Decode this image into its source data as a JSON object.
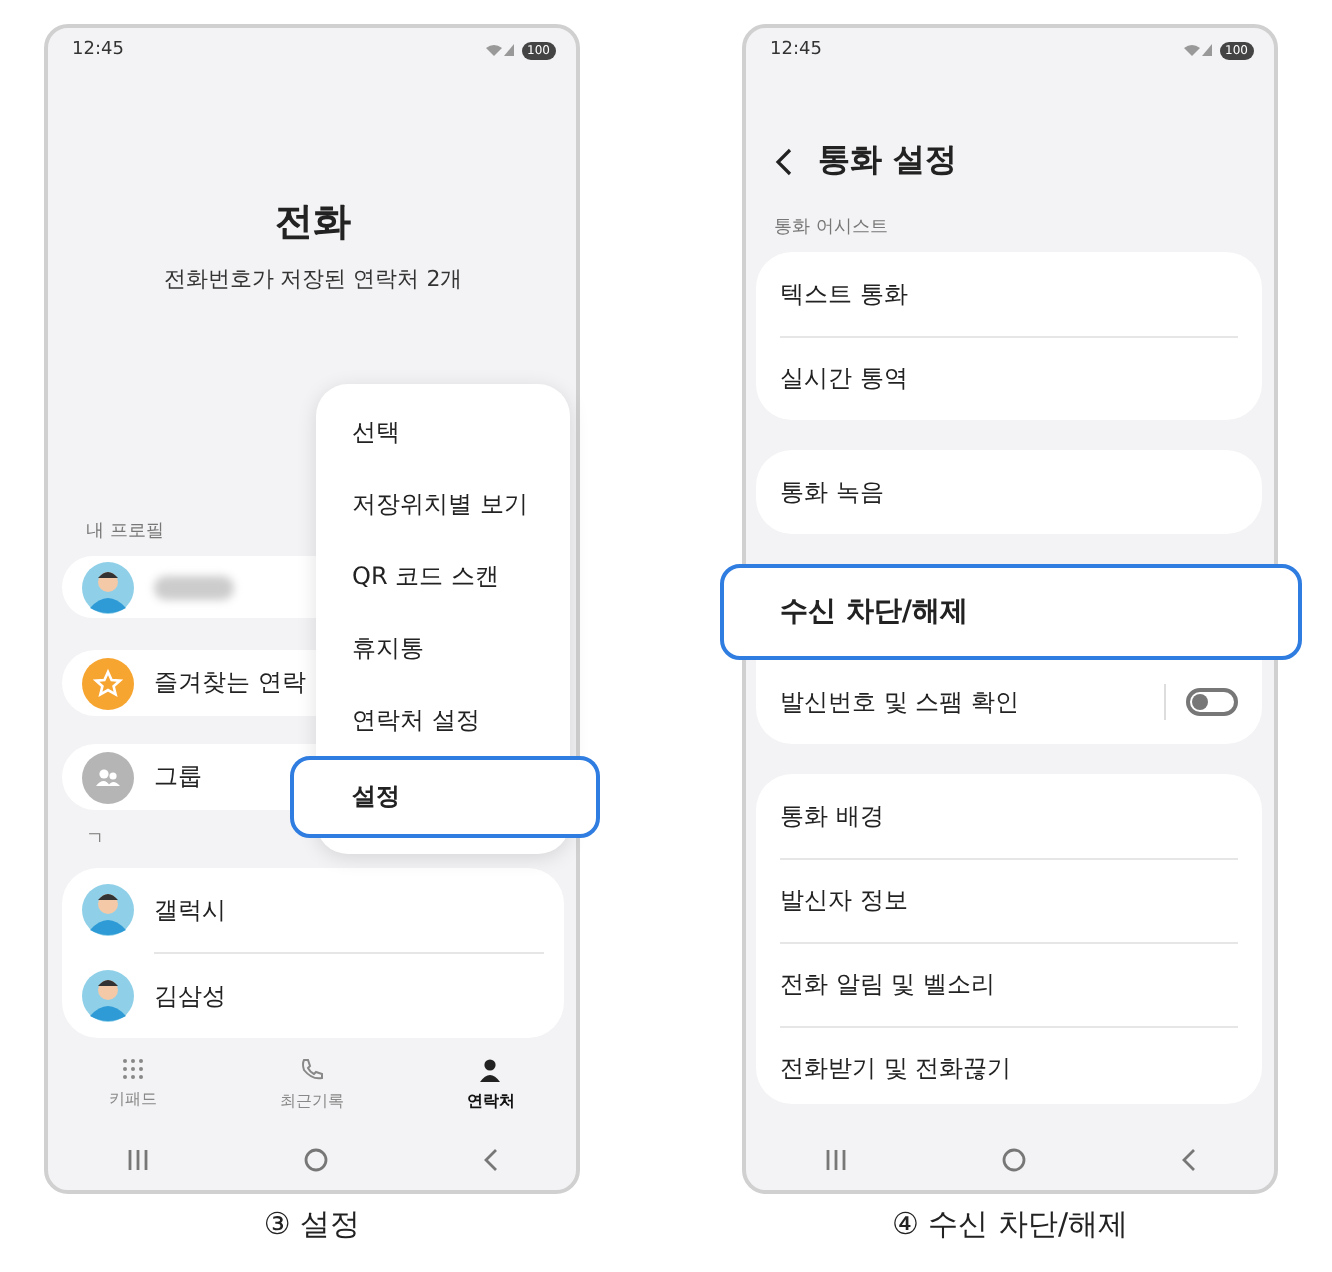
{
  "contacts_screen": {
    "status_time": "12:45",
    "battery": "100",
    "title": "전화",
    "subtitle": "전화번호가 저장된 연락처 2개",
    "profile_label": "내 프로필",
    "favorites": "즐겨찾는 연락",
    "groups": "그룹",
    "index_label": "ㄱ",
    "contacts": [
      "갤럭시",
      "김삼성"
    ],
    "bottom_tabs": [
      {
        "kind": "keypad",
        "label": "키패드",
        "selected": false
      },
      {
        "kind": "recents",
        "label": "최근기록",
        "selected": false
      },
      {
        "kind": "contacts",
        "label": "연락처",
        "selected": true
      }
    ],
    "menu": [
      {
        "label": "선택",
        "selected": false
      },
      {
        "label": "저장위치별 보기",
        "selected": false
      },
      {
        "label": "QR 코드 스캔",
        "selected": false
      },
      {
        "label": "휴지통",
        "selected": false
      },
      {
        "label": "연락처 설정",
        "selected": false
      },
      {
        "label": "설정",
        "selected": true
      }
    ],
    "caption": "③ 설정"
  },
  "call_settings_screen": {
    "status_time": "12:45",
    "battery": "100",
    "title": "통화 설정",
    "section_label": "통화 어시스트",
    "groups": [
      [
        {
          "kind": "link",
          "label": "텍스트 통화",
          "selected": false
        },
        {
          "kind": "link",
          "label": "실시간 통역",
          "selected": false
        }
      ],
      [
        {
          "kind": "link",
          "label": "통화 녹음",
          "selected": false
        }
      ],
      [
        {
          "kind": "link",
          "label": "수신 차단/해제",
          "selected": true
        },
        {
          "kind": "toggle",
          "label": "발신번호 및 스팸 확인",
          "on": false,
          "selected": false
        }
      ],
      [
        {
          "kind": "link",
          "label": "통화 배경",
          "selected": false
        },
        {
          "kind": "link",
          "label": "발신자 정보",
          "selected": false
        },
        {
          "kind": "link",
          "label": "전화 알림 및 벨소리",
          "selected": false
        },
        {
          "kind": "link",
          "label": "전화받기 및 전화끊기",
          "selected": false
        }
      ]
    ],
    "caption": "④ 수신 차단/해제"
  }
}
